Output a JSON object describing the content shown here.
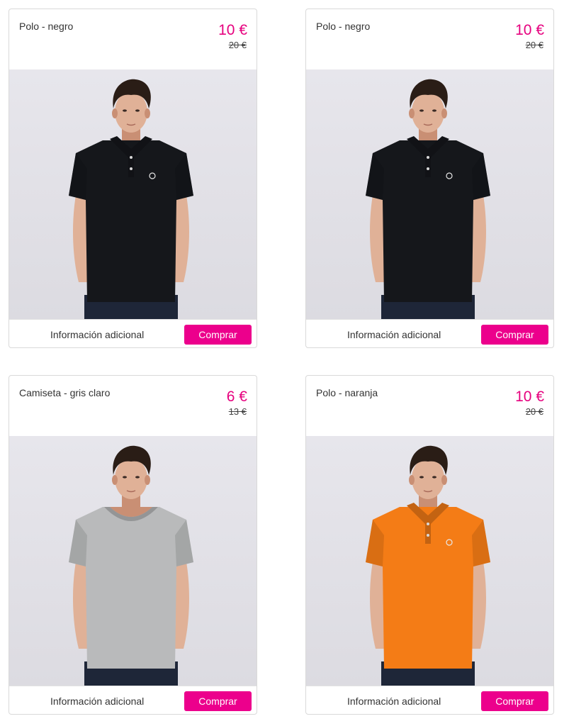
{
  "products": [
    {
      "title": "Polo - negro",
      "price": "10 €",
      "old_price": "20 €",
      "info_label": "Información adicional",
      "buy_label": "Comprar",
      "garment": "polo",
      "garment_color": "#15171b"
    },
    {
      "title": "Polo - negro",
      "price": "10 €",
      "old_price": "20 €",
      "info_label": "Información adicional",
      "buy_label": "Comprar",
      "garment": "polo",
      "garment_color": "#15171b"
    },
    {
      "title": "Camiseta - gris claro",
      "price": "6 €",
      "old_price": "13 €",
      "info_label": "Información adicional",
      "buy_label": "Comprar",
      "garment": "tshirt",
      "garment_color": "#b9babb"
    },
    {
      "title": "Polo - naranja",
      "price": "10 €",
      "old_price": "20 €",
      "info_label": "Información adicional",
      "buy_label": "Comprar",
      "garment": "polo",
      "garment_color": "#f47c16"
    }
  ],
  "colors": {
    "accent": "#ec008c",
    "price": "#e6007e",
    "photo_background": "#e3e2e8"
  }
}
